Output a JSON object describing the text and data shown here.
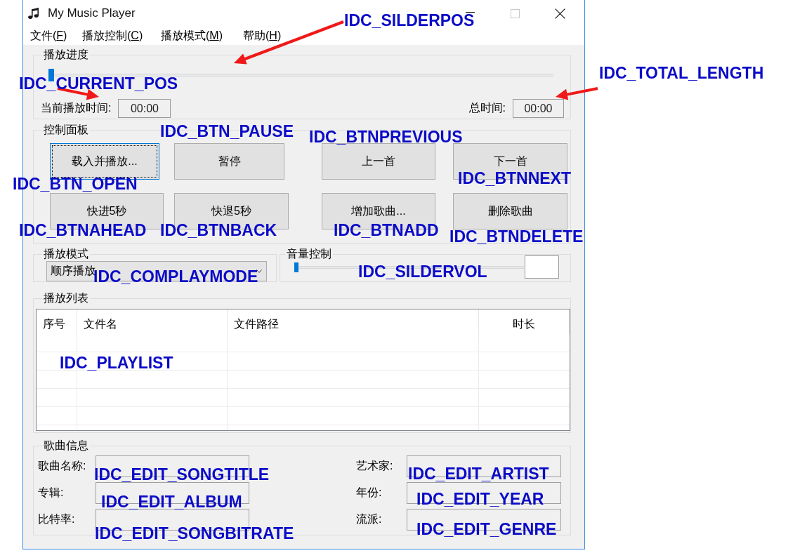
{
  "window": {
    "title": "My Music Player",
    "caption_buttons": [
      {
        "kind": "minimize",
        "disabled": false
      },
      {
        "kind": "maximize",
        "disabled": true
      },
      {
        "kind": "close",
        "disabled": false
      }
    ]
  },
  "menu": [
    {
      "text_before": "文件(",
      "mnemonic": "F",
      "text_after": ")"
    },
    {
      "text_before": "播放控制(",
      "mnemonic": "C",
      "text_after": ")"
    },
    {
      "text_before": "播放模式(",
      "mnemonic": "M",
      "text_after": ")"
    },
    {
      "text_before": "帮助(",
      "mnemonic": "H",
      "text_after": ")"
    }
  ],
  "playback_progress": {
    "title": "播放进度",
    "slider": {
      "level": 0
    },
    "current_time": {
      "label": "当前播放时间:",
      "value": "00:00"
    },
    "total_time": {
      "label": "总时间:",
      "value": "00:00"
    }
  },
  "control_panel": {
    "title": "控制面板",
    "buttons": [
      {
        "label": "载入并播放...",
        "focused": true
      },
      {
        "label": "暂停",
        "focused": false
      },
      {
        "label": "上一首",
        "focused": false
      },
      {
        "label": "下一首",
        "focused": false
      },
      {
        "label": "快进5秒",
        "focused": false
      },
      {
        "label": "快退5秒",
        "focused": false
      },
      {
        "label": "增加歌曲...",
        "focused": false
      },
      {
        "label": "删除歌曲",
        "focused": false
      }
    ]
  },
  "play_mode": {
    "title": "播放模式",
    "dropdown": {
      "value": "顺序播放"
    }
  },
  "volume": {
    "title": "音量控制",
    "slider": {
      "level": 0
    }
  },
  "playlist": {
    "title": "播放列表",
    "columns": [
      "序号",
      "文件名",
      "文件路径",
      "时长"
    ]
  },
  "song_info": {
    "title": "歌曲信息",
    "fields": [
      {
        "label": "歌曲名称:"
      },
      {
        "label": "艺术家:"
      },
      {
        "label": "专辑:"
      },
      {
        "label": "年份:"
      },
      {
        "label": "比特率:"
      },
      {
        "label": "流派:"
      }
    ]
  },
  "annotations": [
    "IDC_SILDERPOS",
    "IDC_TOTAL_LENGTH",
    "IDC_CURRENT_POS",
    "IDC_BTN_PAUSE",
    "IDC_BTNPREVIOUS",
    "IDC_BTNNEXT",
    "IDC_BTN_OPEN",
    "IDC_BTNAHEAD",
    "IDC_BTNBACK",
    "IDC_BTNADD",
    "IDC_BTNDELETE",
    "IDC_COMPLAYMODE",
    "IDC_SILDERVOL",
    "IDC_PLAYLIST",
    "IDC_EDIT_SONGTITLE",
    "IDC_EDIT_ARTIST",
    "IDC_EDIT_ALBUM",
    "IDC_EDIT_YEAR",
    "IDC_EDIT_SONGBITRATE",
    "IDC_EDIT_GENRE"
  ]
}
